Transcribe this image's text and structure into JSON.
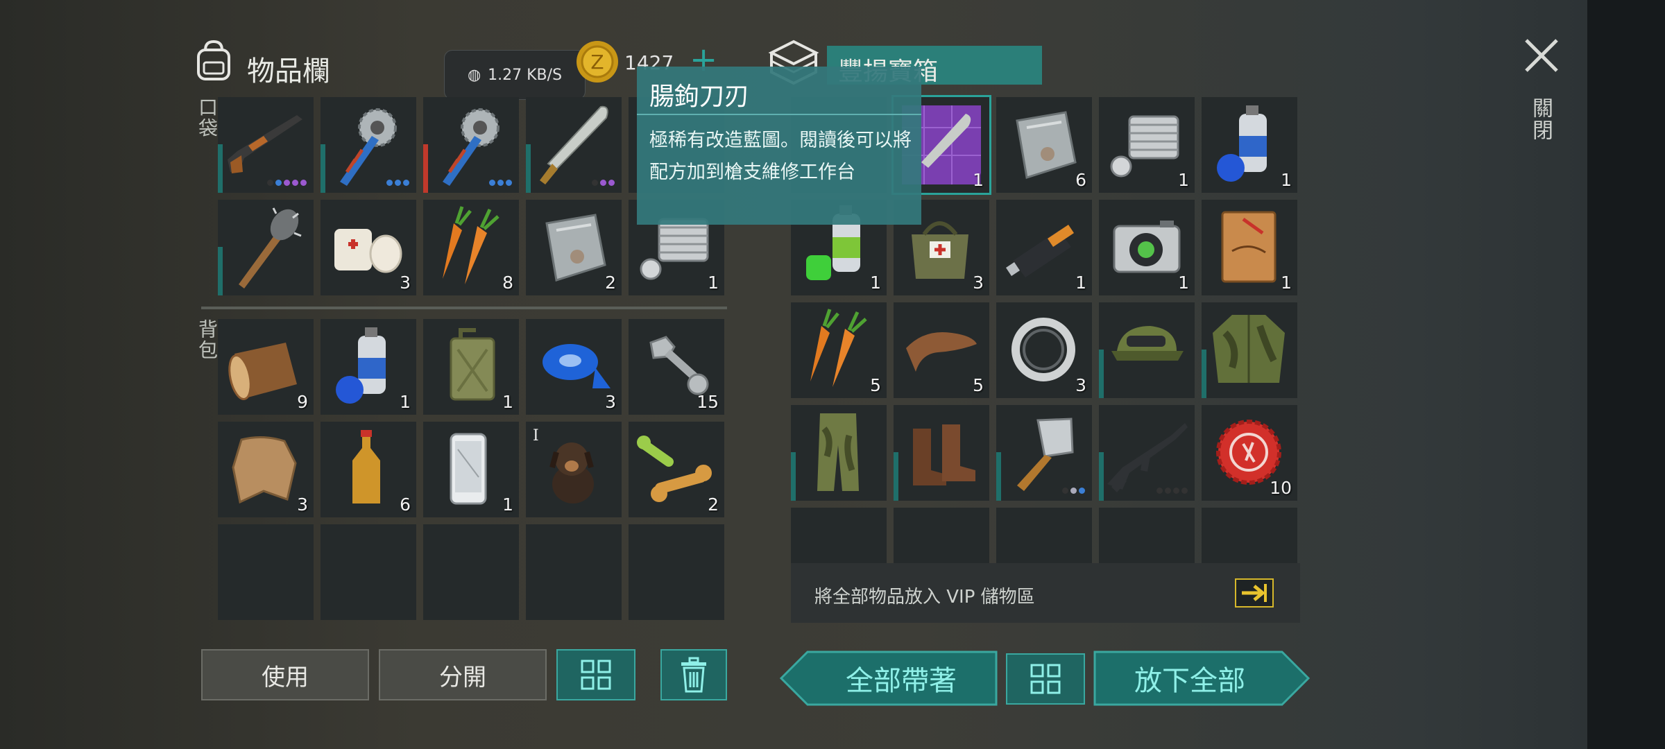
{
  "header": {
    "inventory_title": "物品欄",
    "network_speed": "1.27 KB/S",
    "coins": "1427",
    "add_label": "+",
    "chest_title": "豐揚寶箱",
    "close_label": "關閉"
  },
  "section_labels": {
    "pocket": "口袋",
    "backpack": "背包"
  },
  "tooltip": {
    "title": "腸鉤刀刃",
    "description": "極稀有改造藍圖。閱讀後可以將配方加到槍支維修工作台"
  },
  "pocket_items": [
    {
      "icon": "pump-shotgun-icon",
      "count": ""
    },
    {
      "icon": "saw-mace-icon",
      "count": ""
    },
    {
      "icon": "saw-mace-icon",
      "count": ""
    },
    {
      "icon": "machete-icon",
      "count": ""
    },
    {
      "icon": "hidden-slot",
      "count": ""
    },
    {
      "icon": "spiked-bat-icon",
      "count": ""
    },
    {
      "icon": "bandage-icon",
      "count": "3"
    },
    {
      "icon": "carrot-icon",
      "count": "8"
    },
    {
      "icon": "metal-plate-icon",
      "count": "2"
    },
    {
      "icon": "engine-cylinder-icon",
      "count": "1"
    }
  ],
  "backpack_items": [
    {
      "icon": "wood-log-icon",
      "count": "9"
    },
    {
      "icon": "spray-paint-blue-icon",
      "count": "1"
    },
    {
      "icon": "jerry-can-icon",
      "count": "1"
    },
    {
      "icon": "duct-tape-icon",
      "count": "3"
    },
    {
      "icon": "bolt-nut-icon",
      "count": "15"
    },
    {
      "icon": "animal-hide-icon",
      "count": "3"
    },
    {
      "icon": "bottle-icon",
      "count": "6"
    },
    {
      "icon": "smartphone-icon",
      "count": "1"
    },
    {
      "icon": "puppy-icon",
      "count": "",
      "tag": "I"
    },
    {
      "icon": "dog-bone-icon",
      "count": "2"
    },
    {
      "icon": "",
      "count": ""
    },
    {
      "icon": "",
      "count": ""
    },
    {
      "icon": "",
      "count": ""
    },
    {
      "icon": "",
      "count": ""
    },
    {
      "icon": "",
      "count": ""
    }
  ],
  "chest_items": [
    {
      "icon": "hidden-slot",
      "count": ""
    },
    {
      "icon": "blueprint-icon",
      "count": "1"
    },
    {
      "icon": "metal-plate-icon",
      "count": "6"
    },
    {
      "icon": "engine-cylinder-icon",
      "count": "1"
    },
    {
      "icon": "spray-paint-blue-icon",
      "count": "1"
    },
    {
      "icon": "spray-paint-green-icon",
      "count": "1"
    },
    {
      "icon": "medic-bag-icon",
      "count": "3"
    },
    {
      "icon": "usb-drive-icon",
      "count": "1"
    },
    {
      "icon": "camera-icon",
      "count": "1"
    },
    {
      "icon": "diary-icon",
      "count": "1"
    },
    {
      "icon": "carrot-icon",
      "count": "5"
    },
    {
      "icon": "leather-icon",
      "count": "5"
    },
    {
      "icon": "bearing-icon",
      "count": "3"
    },
    {
      "icon": "military-cap-icon",
      "count": ""
    },
    {
      "icon": "camo-jacket-icon",
      "count": ""
    },
    {
      "icon": "camo-pants-icon",
      "count": ""
    },
    {
      "icon": "boots-icon",
      "count": ""
    },
    {
      "icon": "cleaver-icon",
      "count": ""
    },
    {
      "icon": "assault-rifle-icon",
      "count": ""
    },
    {
      "icon": "bottle-cap-icon",
      "count": "10"
    },
    {
      "icon": "",
      "count": ""
    },
    {
      "icon": "",
      "count": ""
    },
    {
      "icon": "",
      "count": ""
    },
    {
      "icon": "",
      "count": ""
    },
    {
      "icon": "",
      "count": ""
    }
  ],
  "vip": {
    "text": "將全部物品放入 VIP 儲物區"
  },
  "buttons": {
    "use": "使用",
    "split": "分開",
    "take_all": "全部帶著",
    "drop_all": "放下全部"
  },
  "colors": {
    "accent_teal": "#2aa39a",
    "tooltip_bg": "#34787c",
    "rarity_purple": "#9b59d0",
    "rarity_blue": "#3b7fd6",
    "durability_teal": "#1f6f6a",
    "durability_red": "#c0392b"
  }
}
